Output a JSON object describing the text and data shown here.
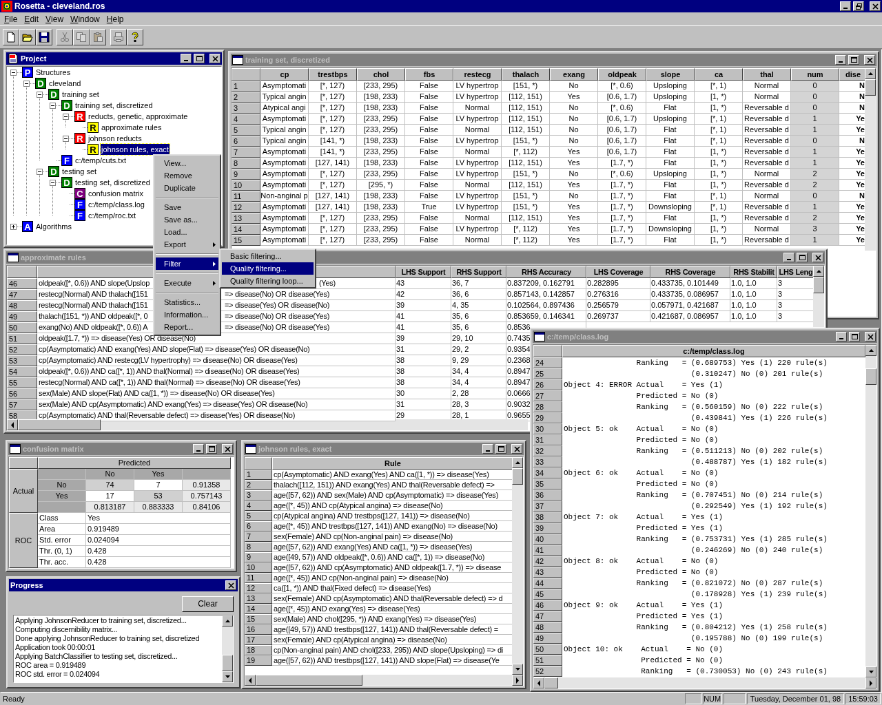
{
  "app": {
    "title": "Rosetta - cleveland.ros"
  },
  "menu_bar": [
    {
      "label": "File"
    },
    {
      "label": "Edit"
    },
    {
      "label": "View"
    },
    {
      "label": "Window"
    },
    {
      "label": "Help"
    }
  ],
  "toolbar": [
    {
      "kind": "new",
      "disabled": false
    },
    {
      "kind": "open",
      "disabled": false
    },
    {
      "kind": "save",
      "disabled": false
    },
    {
      "kind": "separator"
    },
    {
      "kind": "cut",
      "disabled": true
    },
    {
      "kind": "copy",
      "disabled": true
    },
    {
      "kind": "paste",
      "disabled": true
    },
    {
      "kind": "separator"
    },
    {
      "kind": "print",
      "disabled": true
    },
    {
      "kind": "help",
      "disabled": false
    }
  ],
  "project_window": {
    "kind": "project",
    "title": "Project",
    "active": true,
    "tree": [
      {
        "label": "Structures",
        "badge": "P",
        "color": "#0000ff",
        "expanded": true,
        "selected": false,
        "children": [
          {
            "label": "cleveland",
            "badge": "D",
            "color": "#008000",
            "expanded": true,
            "selected": false,
            "children": [
              {
                "label": "training set",
                "badge": "D",
                "color": "#008000",
                "expanded": true,
                "selected": false,
                "children": [
                  {
                    "label": "training set, discretized",
                    "badge": "D",
                    "color": "#008000",
                    "expanded": true,
                    "selected": false,
                    "children": [
                      {
                        "label": "reducts, genetic, approximate",
                        "badge": "R",
                        "color": "#ff0000",
                        "expanded": true,
                        "selected": false,
                        "children": [
                          {
                            "label": "approximate rules",
                            "badge": "R",
                            "color": "#ffff00",
                            "selected": false
                          }
                        ]
                      },
                      {
                        "label": "johnson reducts",
                        "badge": "R",
                        "color": "#ff0000",
                        "expanded": true,
                        "selected": false,
                        "children": [
                          {
                            "label": "johnson rules, exact",
                            "badge": "R",
                            "color": "#ffff00",
                            "selected": true
                          }
                        ]
                      }
                    ]
                  },
                  {
                    "label": "c:/temp/cuts.txt",
                    "badge": "F",
                    "color": "#0000ff",
                    "selected": false
                  }
                ]
              },
              {
                "label": "testing set",
                "badge": "D",
                "color": "#008000",
                "expanded": true,
                "selected": false,
                "children": [
                  {
                    "label": "testing set, discretized",
                    "badge": "D",
                    "color": "#008000",
                    "expanded": true,
                    "selected": false,
                    "children": [
                      {
                        "label": "confusion matrix",
                        "badge": "C",
                        "color": "#800080",
                        "selected": false
                      },
                      {
                        "label": "c:/temp/class.log",
                        "badge": "F",
                        "color": "#0000ff",
                        "selected": false
                      },
                      {
                        "label": "c:/temp/roc.txt",
                        "badge": "F",
                        "color": "#0000ff",
                        "selected": false
                      }
                    ]
                  }
                ]
              }
            ]
          }
        ]
      },
      {
        "label": "Algorithms",
        "badge": "A",
        "color": "#0000ff",
        "expanded": false,
        "selected": false
      }
    ]
  },
  "training_window": {
    "kind": "document",
    "title": "training set, discretized",
    "active": false,
    "columns": [
      {
        "label": "cp",
        "kind": "condition"
      },
      {
        "label": "trestbps",
        "kind": "condition"
      },
      {
        "label": "chol",
        "kind": "condition"
      },
      {
        "label": "fbs",
        "kind": "condition"
      },
      {
        "label": "restecg",
        "kind": "condition"
      },
      {
        "label": "thalach",
        "kind": "condition"
      },
      {
        "label": "exang",
        "kind": "condition"
      },
      {
        "label": "oldpeak",
        "kind": "condition"
      },
      {
        "label": "slope",
        "kind": "condition"
      },
      {
        "label": "ca",
        "kind": "condition"
      },
      {
        "label": "thal",
        "kind": "condition"
      },
      {
        "label": "num",
        "kind": "decision"
      },
      {
        "label": "dise",
        "kind": "prediction"
      }
    ],
    "rows": [
      {
        "index": "1",
        "cells": [
          "Asymptomati",
          "[*, 127)",
          "[233, 295)",
          "False",
          "LV hypertrop",
          "[151, *)",
          "No",
          "[*, 0.6)",
          "Upsloping",
          "[*, 1)",
          "Normal",
          "0",
          "N"
        ]
      },
      {
        "index": "2",
        "cells": [
          "Typical angin",
          "[*, 127)",
          "[198, 233)",
          "False",
          "LV hypertrop",
          "[112, 151)",
          "Yes",
          "[0.6, 1.7)",
          "Upsloping",
          "[1, *)",
          "Normal",
          "0",
          "N"
        ]
      },
      {
        "index": "3",
        "cells": [
          "Atypical angi",
          "[*, 127)",
          "[198, 233)",
          "False",
          "Normal",
          "[112, 151)",
          "No",
          "[*, 0.6)",
          "Flat",
          "[1, *)",
          "Reversable d",
          "0",
          "N"
        ]
      },
      {
        "index": "4",
        "cells": [
          "Asymptomati",
          "[*, 127)",
          "[233, 295)",
          "False",
          "LV hypertrop",
          "[112, 151)",
          "No",
          "[0.6, 1.7)",
          "Upsloping",
          "[*, 1)",
          "Reversable d",
          "1",
          "Ye"
        ]
      },
      {
        "index": "5",
        "cells": [
          "Typical angin",
          "[*, 127)",
          "[233, 295)",
          "False",
          "Normal",
          "[112, 151)",
          "No",
          "[0.6, 1.7)",
          "Flat",
          "[*, 1)",
          "Reversable d",
          "1",
          "Ye"
        ]
      },
      {
        "index": "6",
        "cells": [
          "Typical angin",
          "[141, *)",
          "[198, 233)",
          "False",
          "LV hypertrop",
          "[151, *)",
          "No",
          "[0.6, 1.7)",
          "Flat",
          "[*, 1)",
          "Reversable d",
          "0",
          "N"
        ]
      },
      {
        "index": "7",
        "cells": [
          "Asymptomati",
          "[141, *)",
          "[233, 295)",
          "False",
          "Normal",
          "[*, 112)",
          "Yes",
          "[0.6, 1.7)",
          "Flat",
          "[1, *)",
          "Reversable d",
          "1",
          "Ye"
        ]
      },
      {
        "index": "8",
        "cells": [
          "Asymptomati",
          "[127, 141)",
          "[198, 233)",
          "False",
          "LV hypertrop",
          "[112, 151)",
          "Yes",
          "[1.7, *)",
          "Flat",
          "[1, *)",
          "Reversable d",
          "1",
          "Ye"
        ]
      },
      {
        "index": "9",
        "cells": [
          "Asymptomati",
          "[*, 127)",
          "[233, 295)",
          "False",
          "LV hypertrop",
          "[151, *)",
          "No",
          "[*, 0.6)",
          "Upsloping",
          "[1, *)",
          "Normal",
          "2",
          "Ye"
        ]
      },
      {
        "index": "10",
        "cells": [
          "Asymptomati",
          "[*, 127)",
          "[295, *)",
          "False",
          "Normal",
          "[112, 151)",
          "Yes",
          "[1.7, *)",
          "Flat",
          "[1, *)",
          "Reversable d",
          "2",
          "Ye"
        ]
      },
      {
        "index": "11",
        "cells": [
          "Non-anginal p",
          "[127, 141)",
          "[198, 233)",
          "False",
          "LV hypertrop",
          "[151, *)",
          "No",
          "[1.7, *)",
          "Flat",
          "[*, 1)",
          "Normal",
          "0",
          "N"
        ]
      },
      {
        "index": "12",
        "cells": [
          "Asymptomati",
          "[127, 141)",
          "[198, 233)",
          "True",
          "LV hypertrop",
          "[151, *)",
          "Yes",
          "[1.7, *)",
          "Downsloping",
          "[*, 1)",
          "Reversable d",
          "1",
          "Ye"
        ]
      },
      {
        "index": "13",
        "cells": [
          "Asymptomati",
          "[*, 127)",
          "[233, 295)",
          "False",
          "Normal",
          "[112, 151)",
          "Yes",
          "[1.7, *)",
          "Flat",
          "[1, *)",
          "Reversable d",
          "2",
          "Ye"
        ]
      },
      {
        "index": "14",
        "cells": [
          "Asymptomati",
          "[*, 127)",
          "[233, 295)",
          "False",
          "LV hypertrop",
          "[*, 112)",
          "Yes",
          "[1.7, *)",
          "Downsloping",
          "[1, *)",
          "Normal",
          "3",
          "Ye"
        ]
      },
      {
        "index": "15",
        "cells": [
          "Asymptomati",
          "[*, 127)",
          "[233, 295)",
          "False",
          "Normal",
          "[*, 112)",
          "Yes",
          "[1.7, *)",
          "Flat",
          "[1, *)",
          "Reversable d",
          "1",
          "Ye"
        ]
      }
    ]
  },
  "approx_window": {
    "kind": "document",
    "title": "approximate rules",
    "active": false,
    "columns": [
      "LHS Support",
      "RHS Support",
      "RHS Accuracy",
      "LHS Coverage",
      "RHS Coverage",
      "RHS Stabilit",
      "LHS Leng"
    ],
    "rows": [
      {
        "index": "46",
        "rule": "oldpeak([*, 0.6)) AND slope(Upslop",
        "rule_tail": "(Yes)",
        "cells": [
          "43",
          "36, 7",
          "0.837209, 0.162791",
          "0.282895",
          "0.433735, 0.101449",
          "1.0, 1.0",
          "3"
        ]
      },
      {
        "index": "47",
        "rule": "restecg(Normal) AND thalach([151",
        "rule_tail": "=> disease(No) OR disease(Yes)",
        "cells": [
          "42",
          "36, 6",
          "0.857143, 0.142857",
          "0.276316",
          "0.433735, 0.086957",
          "1.0, 1.0",
          "3"
        ]
      },
      {
        "index": "48",
        "rule": "restecg(Normal) AND thalach([151",
        "rule_tail": "=> disease(Yes) OR disease(No)",
        "cells": [
          "39",
          "4, 35",
          "0.102564, 0.897436",
          "0.256579",
          "0.057971, 0.421687",
          "1.0, 1.0",
          "3"
        ]
      },
      {
        "index": "49",
        "rule": "thalach([151, *)) AND oldpeak([*, 0",
        "rule_tail": "=> disease(No) OR disease(Yes)",
        "cells": [
          "41",
          "35, 6",
          "0.853659, 0.146341",
          "0.269737",
          "0.421687, 0.086957",
          "1.0, 1.0",
          "3"
        ]
      },
      {
        "index": "50",
        "rule": "exang(No) AND oldpeak([*, 0.6)) A",
        "rule_tail": "=> disease(No) OR disease(Yes)",
        "cells": [
          "41",
          "35, 6",
          "0.8536"
        ]
      },
      {
        "index": "51",
        "rule": "oldpeak([1.7, *)) => disease(Yes) OR disease(No)",
        "cells": [
          "39",
          "29, 10",
          "0.7435"
        ]
      },
      {
        "index": "52",
        "rule": "cp(Asymptomatic) AND exang(Yes) AND slope(Flat) => disease(Yes) OR disease(No)",
        "cells": [
          "31",
          "29, 2",
          "0.9354"
        ]
      },
      {
        "index": "53",
        "rule": "cp(Asymptomatic) AND restecg(LV hypertrophy) => disease(No) OR disease(Yes)",
        "cells": [
          "38",
          "9, 29",
          "0.2368"
        ]
      },
      {
        "index": "54",
        "rule": "oldpeak([*, 0.6)) AND ca([*, 1)) AND thal(Normal) => disease(No) OR disease(Yes)",
        "cells": [
          "38",
          "34, 4",
          "0.8947"
        ]
      },
      {
        "index": "55",
        "rule": "restecg(Normal) AND ca([*, 1)) AND thal(Normal) => disease(No) OR disease(Yes)",
        "cells": [
          "38",
          "34, 4",
          "0.8947"
        ]
      },
      {
        "index": "56",
        "rule": "sex(Male) AND slope(Flat) AND ca([1, *)) => disease(No) OR disease(Yes)",
        "cells": [
          "30",
          "2, 28",
          "0.0666"
        ]
      },
      {
        "index": "57",
        "rule": "sex(Male) AND cp(Asymptomatic) AND exang(Yes) => disease(Yes) OR disease(No)",
        "cells": [
          "31",
          "28, 3",
          "0.9032"
        ]
      },
      {
        "index": "58",
        "rule": "cp(Asymptomatic) AND thal(Reversable defect) => disease(Yes) OR disease(No)",
        "cells": [
          "29",
          "28, 1",
          "0.9655"
        ]
      }
    ]
  },
  "confusion_window": {
    "kind": "document",
    "title": "confusion matrix",
    "active": false,
    "predicted_label": "Predicted",
    "actual_label": "Actual",
    "classes": [
      "No",
      "Yes"
    ],
    "rows": [
      {
        "label": "No",
        "counts": [
          "74",
          "7"
        ],
        "ratio": "0.91358"
      },
      {
        "label": "Yes",
        "counts": [
          "17",
          "53"
        ],
        "ratio": "0.757143"
      }
    ],
    "column_ratios": [
      "0.813187",
      "0.883333"
    ],
    "overall_ratio": "0.84106",
    "roc_label": "ROC",
    "roc": [
      {
        "label": "Class",
        "value": "Yes"
      },
      {
        "label": "Area",
        "value": "0.919489"
      },
      {
        "label": "Std. error",
        "value": "0.024094"
      },
      {
        "label": "Thr. (0, 1)",
        "value": "0.428"
      },
      {
        "label": "Thr. acc.",
        "value": "0.428"
      }
    ]
  },
  "progress_window": {
    "kind": "tool",
    "title": "Progress",
    "active": true,
    "clear_button": "Clear",
    "lines": [
      "Applying JohnsonReducer to training set, discretized...",
      "Computing discernibility matrix...",
      "Done applying JohnsonReducer to training set, discretized",
      "Application took 00:00:01",
      "Applying BatchClassifier to testing set, discretized...",
      "ROC area = 0.919489",
      "ROC std. error = 0.024094"
    ]
  },
  "johnson_window": {
    "kind": "document",
    "title": "johnson rules, exact",
    "active": false,
    "header": "Rule",
    "rows": [
      {
        "index": "1",
        "rule": "cp(Asymptomatic) AND exang(Yes) AND ca([1, *)) => disease(Yes)"
      },
      {
        "index": "2",
        "rule": "thalach([112, 151)) AND exang(Yes) AND thal(Reversable defect) =>"
      },
      {
        "index": "3",
        "rule": "age([57, 62)) AND sex(Male) AND cp(Asymptomatic) => disease(Yes)"
      },
      {
        "index": "4",
        "rule": "age([*, 45)) AND cp(Atypical angina) => disease(No)"
      },
      {
        "index": "5",
        "rule": "cp(Atypical angina) AND trestbps([127, 141)) => disease(No)"
      },
      {
        "index": "6",
        "rule": "age([*, 45)) AND trestbps([127, 141)) AND exang(No) => disease(No)"
      },
      {
        "index": "7",
        "rule": "sex(Female) AND cp(Non-anginal pain) => disease(No)"
      },
      {
        "index": "8",
        "rule": "age([57, 62)) AND exang(Yes) AND ca([1, *)) => disease(Yes)"
      },
      {
        "index": "9",
        "rule": "age([49, 57)) AND oldpeak([*, 0.6)) AND ca([*, 1)) => disease(No)"
      },
      {
        "index": "10",
        "rule": "age([57, 62)) AND cp(Asymptomatic) AND oldpeak([1.7, *)) => disease"
      },
      {
        "index": "11",
        "rule": "age([*, 45)) AND cp(Non-anginal pain) => disease(No)"
      },
      {
        "index": "12",
        "rule": "ca([1, *)) AND thal(Fixed defect) => disease(Yes)"
      },
      {
        "index": "13",
        "rule": "sex(Female) AND cp(Asymptomatic) AND thal(Reversable defect) => d"
      },
      {
        "index": "14",
        "rule": "age([*, 45)) AND exang(Yes) => disease(Yes)"
      },
      {
        "index": "15",
        "rule": "sex(Male) AND chol([295, *)) AND exang(Yes) => disease(Yes)"
      },
      {
        "index": "16",
        "rule": "age([49, 57)) AND trestbps([127, 141)) AND thal(Reversable defect) ="
      },
      {
        "index": "17",
        "rule": "sex(Female) AND cp(Atypical angina) => disease(No)"
      },
      {
        "index": "18",
        "rule": "cp(Non-anginal pain) AND chol([233, 295)) AND slope(Upsloping) => di"
      },
      {
        "index": "19",
        "rule": "age([57, 62)) AND trestbps([127, 141)) AND slope(Flat) => disease(Ye"
      }
    ]
  },
  "classlog_window": {
    "kind": "document",
    "title": "c:/temp/class.log",
    "active": false,
    "header": "c:/temp/class.log",
    "lines": [
      {
        "index": "24",
        "text": "                Ranking   = (0.689753) Yes (1) 220 rule(s)"
      },
      {
        "index": "25",
        "text": "                            (0.310247) No (0) 201 rule(s)"
      },
      {
        "index": "26",
        "text": "Object 4: ERROR Actual    = Yes (1)"
      },
      {
        "index": "27",
        "text": "                Predicted = No (0)"
      },
      {
        "index": "28",
        "text": "                Ranking   = (0.560159) No (0) 222 rule(s)"
      },
      {
        "index": "29",
        "text": "                            (0.439841) Yes (1) 226 rule(s)"
      },
      {
        "index": "30",
        "text": "Object 5: ok    Actual    = No (0)"
      },
      {
        "index": "31",
        "text": "                Predicted = No (0)"
      },
      {
        "index": "32",
        "text": "                Ranking   = (0.511213) No (0) 202 rule(s)"
      },
      {
        "index": "33",
        "text": "                            (0.488787) Yes (1) 182 rule(s)"
      },
      {
        "index": "34",
        "text": "Object 6: ok    Actual    = No (0)"
      },
      {
        "index": "35",
        "text": "                Predicted = No (0)"
      },
      {
        "index": "36",
        "text": "                Ranking   = (0.707451) No (0) 214 rule(s)"
      },
      {
        "index": "37",
        "text": "                            (0.292549) Yes (1) 192 rule(s)"
      },
      {
        "index": "38",
        "text": "Object 7: ok    Actual    = Yes (1)"
      },
      {
        "index": "39",
        "text": "                Predicted = Yes (1)"
      },
      {
        "index": "40",
        "text": "                Ranking   = (0.753731) Yes (1) 285 rule(s)"
      },
      {
        "index": "41",
        "text": "                            (0.246269) No (0) 240 rule(s)"
      },
      {
        "index": "42",
        "text": "Object 8: ok    Actual    = No (0)"
      },
      {
        "index": "43",
        "text": "                Predicted = No (0)"
      },
      {
        "index": "44",
        "text": "                Ranking   = (0.821072) No (0) 287 rule(s)"
      },
      {
        "index": "45",
        "text": "                            (0.178928) Yes (1) 239 rule(s)"
      },
      {
        "index": "46",
        "text": "Object 9: ok    Actual    = Yes (1)"
      },
      {
        "index": "47",
        "text": "                Predicted = Yes (1)"
      },
      {
        "index": "48",
        "text": "                Ranking   = (0.804212) Yes (1) 258 rule(s)"
      },
      {
        "index": "49",
        "text": "                            (0.195788) No (0) 199 rule(s)"
      },
      {
        "index": "50",
        "text": "Object 10: ok    Actual    = No (0)"
      },
      {
        "index": "51",
        "text": "                 Predicted = No (0)"
      },
      {
        "index": "52",
        "text": "                 Ranking   = (0.730053) No (0) 243 rule(s)"
      }
    ]
  },
  "context_menu": {
    "items": [
      {
        "kind": "item",
        "label": "View...",
        "selected": false
      },
      {
        "kind": "item",
        "label": "Remove",
        "selected": false
      },
      {
        "kind": "item",
        "label": "Duplicate",
        "selected": false
      },
      {
        "kind": "separator"
      },
      {
        "kind": "item",
        "label": "Save",
        "selected": false
      },
      {
        "kind": "item",
        "label": "Save as...",
        "selected": false
      },
      {
        "kind": "item",
        "label": "Load...",
        "selected": false
      },
      {
        "kind": "submenu",
        "label": "Export",
        "selected": false
      },
      {
        "kind": "separator"
      },
      {
        "kind": "submenu",
        "label": "Filter",
        "selected": true
      },
      {
        "kind": "separator"
      },
      {
        "kind": "submenu",
        "label": "Execute",
        "selected": false
      },
      {
        "kind": "separator"
      },
      {
        "kind": "item",
        "label": "Statistics...",
        "selected": false
      },
      {
        "kind": "item",
        "label": "Information...",
        "selected": false
      },
      {
        "kind": "item",
        "label": "Report...",
        "selected": false
      }
    ],
    "submenu": [
      {
        "label": "Basic filtering...",
        "selected": false
      },
      {
        "label": "Quality filtering...",
        "selected": true
      },
      {
        "label": "Quality filtering loop...",
        "selected": false
      }
    ]
  },
  "status_bar": {
    "message": "Ready",
    "num_lock": "NUM",
    "date": "Tuesday, December 01, 98",
    "time": "15:59:03"
  }
}
